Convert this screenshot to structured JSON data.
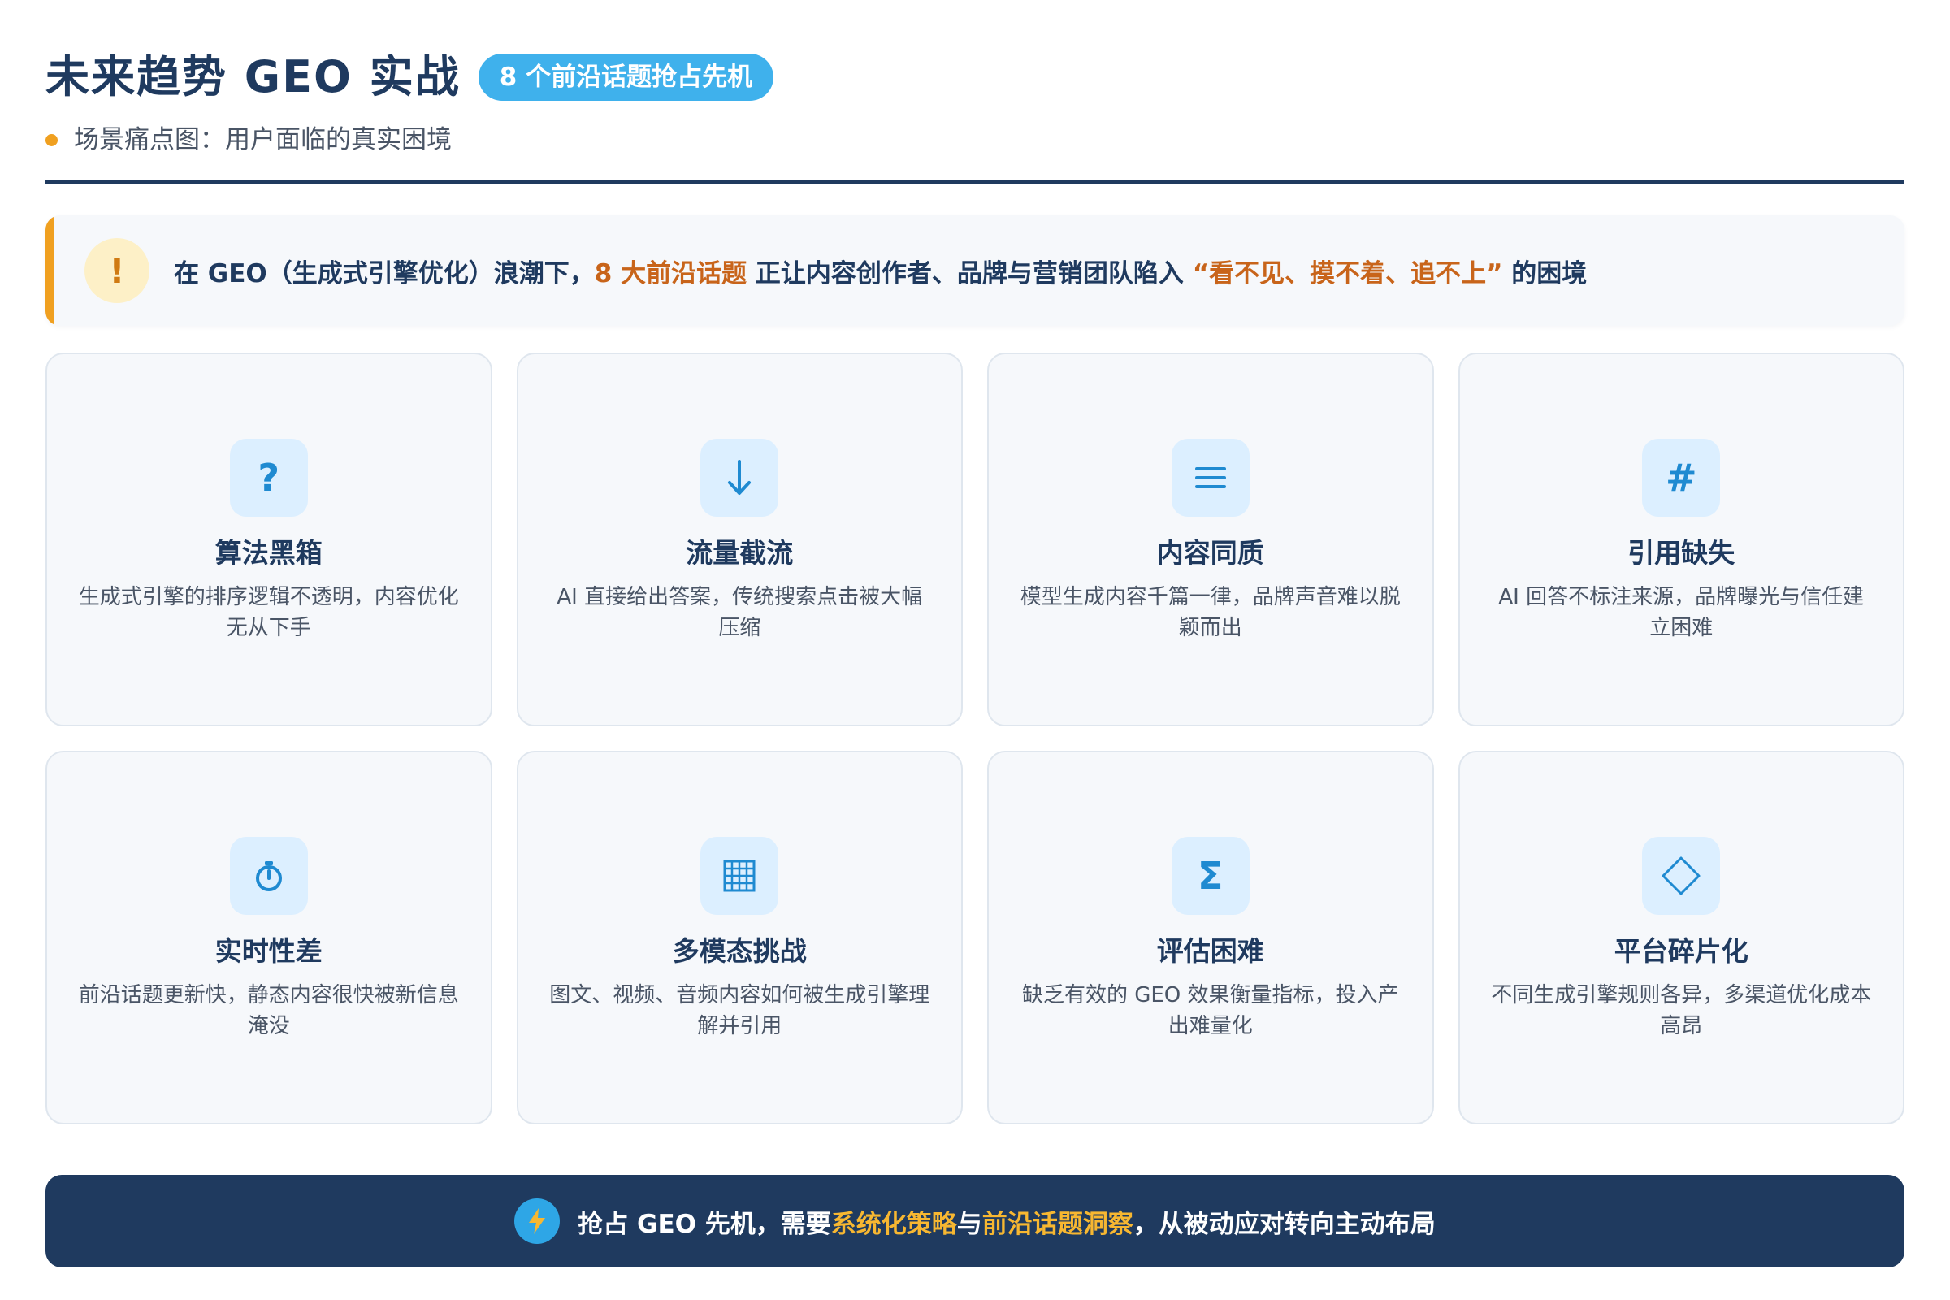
{
  "header": {
    "title": "未来趋势 GEO 实战",
    "badge": "8 个前沿话题抢占先机",
    "subtitle": "场景痛点图：用户面临的真实困境"
  },
  "alert": {
    "icon": "exclamation-icon",
    "text_before": "在 GEO（生成式引擎优化）浪潮下，",
    "highlight_1": "8 大前沿话题",
    "text_middle": " 正让内容创作者、品牌与营销团队陷入 ",
    "highlight_2": "“看不见、摸不着、追不上”",
    "text_after": " 的困境"
  },
  "cards": [
    {
      "icon": "question-icon",
      "title": "算法黑箱",
      "desc": "生成式引擎的排序逻辑不透明，内容优化无从下手"
    },
    {
      "icon": "arrow-down-icon",
      "title": "流量截流",
      "desc": "AI 直接给出答案，传统搜索点击被大幅压缩"
    },
    {
      "icon": "lines-icon",
      "title": "内容同质",
      "desc": "模型生成内容千篇一律，品牌声音难以脱颖而出"
    },
    {
      "icon": "hash-icon",
      "title": "引用缺失",
      "desc": "AI 回答不标注来源，品牌曝光与信任建立困难"
    },
    {
      "icon": "stopwatch-icon",
      "title": "实时性差",
      "desc": "前沿话题更新快，静态内容很快被新信息淹没"
    },
    {
      "icon": "grid-icon",
      "title": "多模态挑战",
      "desc": "图文、视频、音频内容如何被生成引擎理解并引用"
    },
    {
      "icon": "sigma-icon",
      "title": "评估困难",
      "desc": "缺乏有效的 GEO 效果衡量指标，投入产出难量化"
    },
    {
      "icon": "diamond-icon",
      "title": "平台碎片化",
      "desc": "不同生成引擎规则各异，多渠道优化成本高昂"
    }
  ],
  "cta": {
    "icon": "lightning-icon",
    "text_before": "抢占 GEO 先机，需要",
    "highlight_1": "系统化策略",
    "text_middle": "与",
    "highlight_2": "前沿话题洞察",
    "text_after": "，从被动应对转向主动布局"
  },
  "colors": {
    "navy": "#1f3a5f",
    "badge_blue": "#3fb1ec",
    "accent_orange": "#f0a020",
    "highlight_orange": "#c8641a",
    "icon_blue": "#1f8ad1",
    "cta_yellow": "#f7b731"
  }
}
